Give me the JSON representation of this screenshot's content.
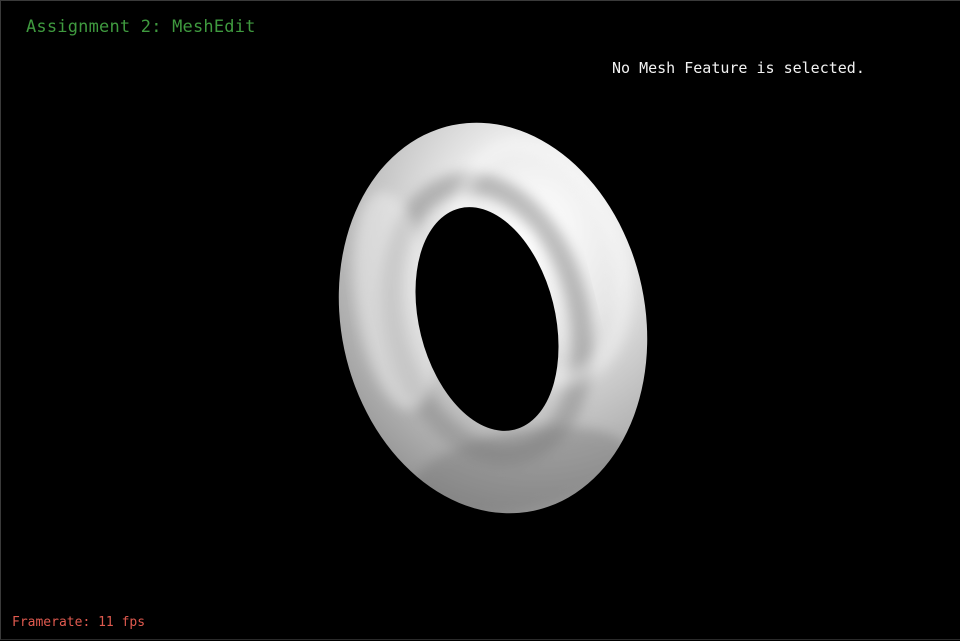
{
  "app": {
    "title": "Assignment 2: MeshEdit",
    "title_color": "#3f9a3f"
  },
  "selection": {
    "status_text": "No Mesh Feature is selected.",
    "text_color": "#f2f2f2"
  },
  "stats": {
    "framerate_text": "Framerate: 11 fps",
    "text_color": "#e05a4f"
  },
  "scene": {
    "background_color": "#000000",
    "mesh_shape": "torus",
    "mesh_color": "#e8e8e8",
    "selected_feature": "none"
  }
}
